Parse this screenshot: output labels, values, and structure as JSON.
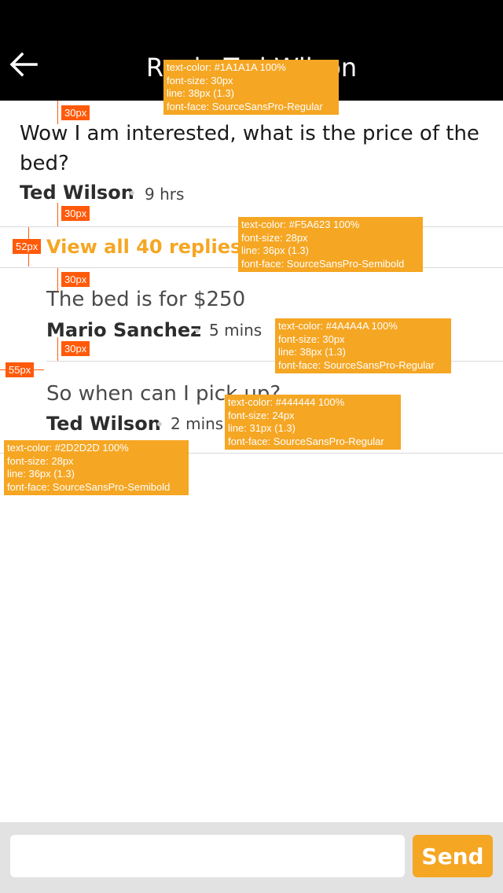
{
  "header": {
    "title": "Reply Ted Wilson",
    "back_icon": "arrow-left-icon"
  },
  "thread": {
    "original": {
      "message_line1": "Wow I am interested, what is the price of the",
      "message_line2": "bed?",
      "author": "Ted Wilson",
      "separator": "•",
      "time": "9 hrs"
    },
    "view_all_label": "View all 40 replies",
    "replies": [
      {
        "message": "The bed is for $250",
        "author": "Mario Sanchez",
        "separator": "•",
        "time": "5 mins"
      },
      {
        "message": "So when can I pick up?",
        "author": "Ted Wilson",
        "separator": "•",
        "time": "2 mins"
      }
    ]
  },
  "annotations": {
    "ann1": {
      "l1": "text-color: #1A1A1A 100%",
      "l2": "font-size: 30px",
      "l3": "line: 38px (1.3)",
      "l4": "font-face: SourceSansPro-Regular"
    },
    "ann2": {
      "l1": "text-color: #F5A623 100%",
      "l2": "font-size: 28px",
      "l3": "line: 36px (1.3)",
      "l4": "font-face: SourceSansPro-Semibold"
    },
    "ann3": {
      "l1": "text-color: #4A4A4A 100%",
      "l2": "font-size: 30px",
      "l3": "line: 38px (1.3)",
      "l4": "font-face: SourceSansPro-Regular"
    },
    "ann4": {
      "l1": "text-color: #444444 100%",
      "l2": "font-size: 24px",
      "l3": "line: 31px (1.3)",
      "l4": "font-face: SourceSansPro-Regular"
    },
    "ann5": {
      "l1": "text-color: #2D2D2D 100%",
      "l2": "font-size: 28px",
      "l3": "line: 36px (1.3)",
      "l4": "font-face: SourceSansPro-Semibold"
    },
    "tags": {
      "t30a": "30px",
      "t30b": "30px",
      "t52": "52px",
      "t30c": "30px",
      "t30d": "30px",
      "t55": "55px"
    }
  },
  "composer": {
    "placeholder": "",
    "send_label": "Send"
  },
  "colors": {
    "accent": "#F5A623",
    "header_bg": "#000000",
    "spec_tag": "#FF5A0A"
  }
}
